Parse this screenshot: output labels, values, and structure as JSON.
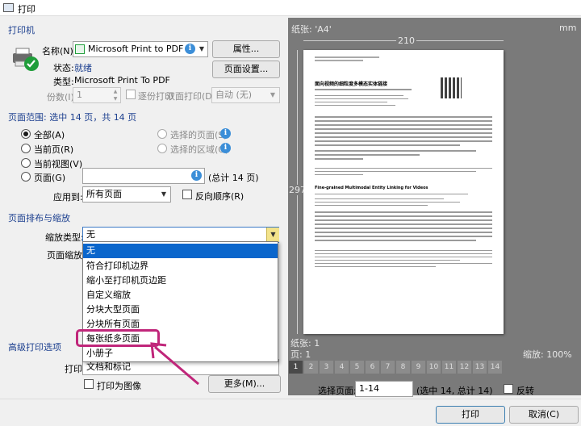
{
  "window": {
    "title": "打印"
  },
  "printer": {
    "section_title": "打印机",
    "name_label": "名称(N):",
    "name_value": "Microsoft Print to PDF",
    "properties_button": "属性...",
    "page_setup_button": "页面设置...",
    "status_label": "状态:",
    "status_value": "就绪",
    "type_label": "类型:",
    "type_value": "Microsoft Print To PDF",
    "copies_label": "份数(I):",
    "copies_value": "1",
    "collate_label": "逐份打印",
    "duplex_label": "双面打印(D):",
    "duplex_value": "自动 (无)"
  },
  "page_range": {
    "section_title": "页面范围: 选中 14 页，共 14 页",
    "all_label": "全部(A)",
    "current_page_label": "当前页(R)",
    "current_view_label": "当前视图(V)",
    "pages_label": "页面(G)",
    "pages_total": "(总计 14 页)",
    "selected_pages_label": "选择的页面(S)",
    "selected_area_label": "选择的区域(G)",
    "apply_to_label": "应用到:",
    "apply_to_value": "所有页面",
    "reverse_label": "反向顺序(R)"
  },
  "layout": {
    "section_title": "页面排布与缩放",
    "scale_type_label": "缩放类型:",
    "scale_type_value": "无",
    "page_scale_label": "页面缩放:",
    "options": [
      "无",
      "符合打印机边界",
      "缩小至打印机页边距",
      "自定义缩放",
      "分块大型页面",
      "分块所有页面",
      "每张纸多页面",
      "小册子"
    ],
    "selected_index": 0,
    "highlighted_index": 6
  },
  "advanced": {
    "section_title": "高级打印选项",
    "print_label": "打印",
    "print_value": "文档和标记",
    "print_as_image_label": "打印为图像",
    "more_button": "更多(M)..."
  },
  "preview": {
    "paper_label": "纸张: 'A4'",
    "unit": "mm",
    "width_value": "210",
    "height_value": "297",
    "sheet_label": "纸张: 1",
    "page_label": "页: 1",
    "zoom_label": "缩放: 100%",
    "page_numbers": [
      "1",
      "2",
      "3",
      "4",
      "5",
      "6",
      "7",
      "8",
      "9",
      "10",
      "11",
      "12",
      "13",
      "14"
    ],
    "select_pages_label": "选择页面:",
    "select_pages_value": "1-14",
    "select_pages_summary": "(选中 14, 总计 14)",
    "reverse_label": "反转",
    "paper_title": "面向视频的细粒度多模态实体链接",
    "paper_en_title": "Fine-grained Multimodal Entity Linking for Videos"
  },
  "footer": {
    "print_button": "打印",
    "cancel_button": "取消(C)"
  },
  "colors": {
    "accent": "#0a66cc",
    "section": "#1c3f8f",
    "highlight": "#c0267a"
  }
}
